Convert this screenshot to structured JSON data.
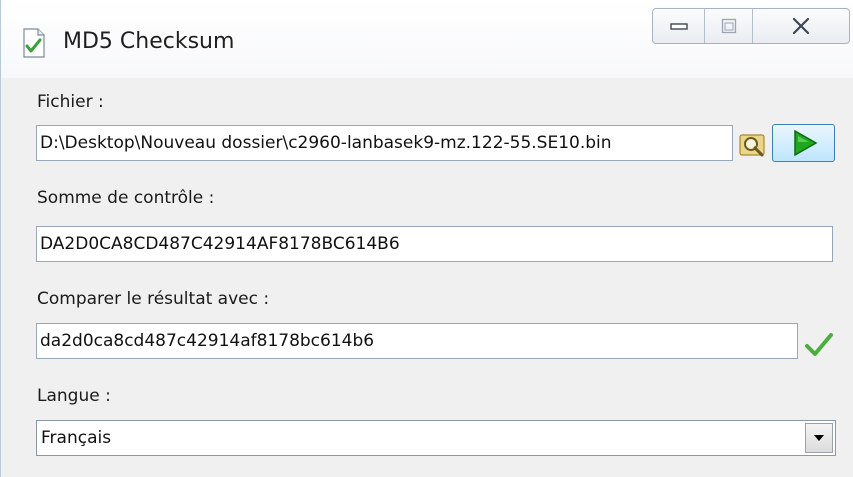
{
  "window": {
    "title": "MD5 Checksum",
    "icon": "document-check-icon",
    "controls": [
      "minimize-icon",
      "maximize-icon",
      "close-icon"
    ]
  },
  "file": {
    "label": "Fichier :",
    "value": "D:\\Desktop\\Nouveau dossier\\c2960-lanbasek9-mz.122-55.SE10.bin",
    "browse_icon": "browse-folder-icon",
    "go_icon": "play-icon"
  },
  "checksum": {
    "label": "Somme de contrôle :",
    "value": "DA2D0CA8CD487C42914AF8178BC614B6"
  },
  "compare": {
    "label": "Comparer le résultat avec :",
    "value": "da2d0ca8cd487c42914af8178bc614b6",
    "status_icon": "checkmark-icon",
    "status_color": "#4cae3f"
  },
  "language": {
    "label": "Langue :",
    "selected": "Français"
  },
  "colors": {
    "go_arrow": "#1fa81f",
    "field_border": "#9aa7b8"
  }
}
